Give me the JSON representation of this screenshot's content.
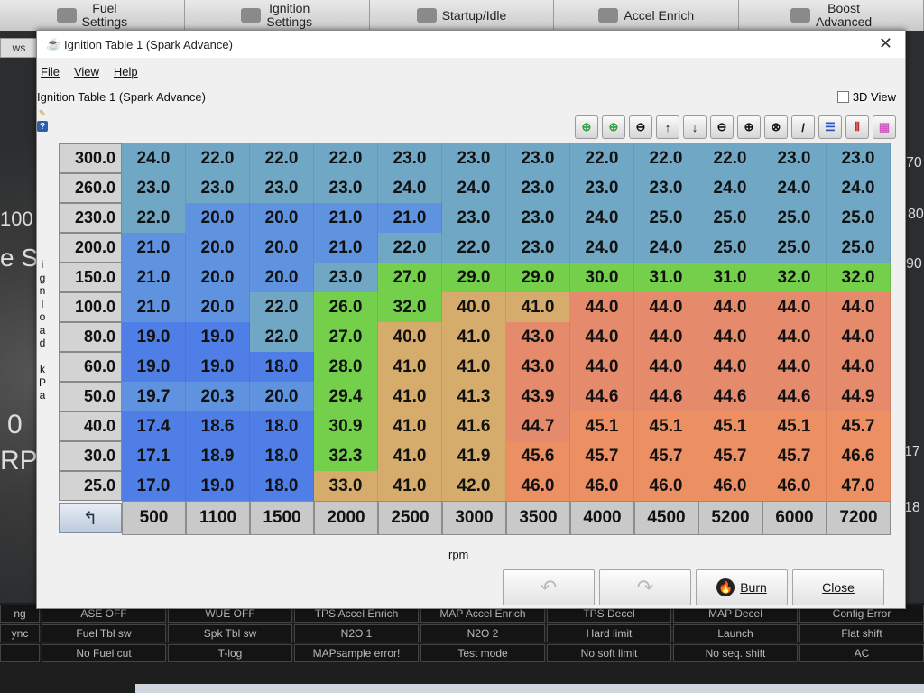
{
  "app": {
    "top_buttons": [
      {
        "label": "Fuel\nSettings",
        "icon": "injector-icon"
      },
      {
        "label": "Ignition\nSettings",
        "icon": "spark-plug-icon"
      },
      {
        "label": "Startup/Idle",
        "icon": "wrench-icon"
      },
      {
        "label": "Accel Enrich",
        "icon": "accelerator-icon"
      },
      {
        "label": "Boost\nAdvanced",
        "icon": "turbo-icon"
      }
    ],
    "side_tab": "ws",
    "gauge_labels": {
      "left_100": "100",
      "left_e": "e S",
      "left_0": "0",
      "left_rpm": "RPI",
      "right_70": "70",
      "right_80": "80",
      "right_90": "90",
      "right_17": "17",
      "right_18": "18"
    }
  },
  "dialog": {
    "title": "Ignition Table 1 (Spark Advance)",
    "menu": [
      "File",
      "View",
      "Help"
    ],
    "table_title": "Ignition Table 1 (Spark Advance)",
    "view3d_label": "3D View",
    "help_glyph": "?",
    "y_axis_label": [
      "i",
      "g",
      "n",
      "l",
      "o",
      "a",
      "d",
      "",
      "k",
      "P",
      "a"
    ],
    "x_axis_label": "rpm",
    "corner_glyph": "↰",
    "toolbar": [
      {
        "name": "increase-green-icon",
        "glyph": "⊕",
        "tone": "g"
      },
      {
        "name": "decrease-green-icon",
        "glyph": "⊕",
        "tone": "g"
      },
      {
        "name": "minus-icon",
        "glyph": "⊖",
        "tone": "k"
      },
      {
        "name": "arrow-up-icon",
        "glyph": "↑",
        "tone": "k"
      },
      {
        "name": "arrow-down-icon",
        "glyph": "↓",
        "tone": "k"
      },
      {
        "name": "decrement-icon",
        "glyph": "⊖",
        "tone": "k"
      },
      {
        "name": "increment-icon",
        "glyph": "⊕",
        "tone": "k"
      },
      {
        "name": "clear-icon",
        "glyph": "⊗",
        "tone": "k"
      },
      {
        "name": "interpolate-pen-icon",
        "glyph": "/",
        "tone": "k"
      },
      {
        "name": "smooth-rows-icon",
        "glyph": "☰",
        "tone": "k"
      },
      {
        "name": "smooth-columns-icon",
        "glyph": "⦀",
        "tone": "k"
      },
      {
        "name": "color-scale-icon",
        "glyph": "▦",
        "tone": "k"
      }
    ],
    "load_bins": [
      "300.0",
      "260.0",
      "230.0",
      "200.0",
      "150.0",
      "100.0",
      "80.0",
      "60.0",
      "50.0",
      "40.0",
      "30.0",
      "25.0"
    ],
    "rpm_bins": [
      "500",
      "1100",
      "1500",
      "2000",
      "2500",
      "3000",
      "3500",
      "4000",
      "4500",
      "5200",
      "6000",
      "7200"
    ],
    "values": [
      [
        "24.0",
        "22.0",
        "22.0",
        "22.0",
        "23.0",
        "23.0",
        "23.0",
        "22.0",
        "22.0",
        "22.0",
        "23.0",
        "23.0"
      ],
      [
        "23.0",
        "23.0",
        "23.0",
        "23.0",
        "24.0",
        "24.0",
        "23.0",
        "23.0",
        "23.0",
        "24.0",
        "24.0",
        "24.0"
      ],
      [
        "22.0",
        "20.0",
        "20.0",
        "21.0",
        "21.0",
        "23.0",
        "23.0",
        "24.0",
        "25.0",
        "25.0",
        "25.0",
        "25.0"
      ],
      [
        "21.0",
        "20.0",
        "20.0",
        "21.0",
        "22.0",
        "22.0",
        "23.0",
        "24.0",
        "24.0",
        "25.0",
        "25.0",
        "25.0"
      ],
      [
        "21.0",
        "20.0",
        "20.0",
        "23.0",
        "27.0",
        "29.0",
        "29.0",
        "30.0",
        "31.0",
        "31.0",
        "32.0",
        "32.0"
      ],
      [
        "21.0",
        "20.0",
        "22.0",
        "26.0",
        "32.0",
        "40.0",
        "41.0",
        "44.0",
        "44.0",
        "44.0",
        "44.0",
        "44.0"
      ],
      [
        "19.0",
        "19.0",
        "22.0",
        "27.0",
        "40.0",
        "41.0",
        "43.0",
        "44.0",
        "44.0",
        "44.0",
        "44.0",
        "44.0"
      ],
      [
        "19.0",
        "19.0",
        "18.0",
        "28.0",
        "41.0",
        "41.0",
        "43.0",
        "44.0",
        "44.0",
        "44.0",
        "44.0",
        "44.0"
      ],
      [
        "19.7",
        "20.3",
        "20.0",
        "29.4",
        "41.0",
        "41.3",
        "43.9",
        "44.6",
        "44.6",
        "44.6",
        "44.6",
        "44.9"
      ],
      [
        "17.4",
        "18.6",
        "18.0",
        "30.9",
        "41.0",
        "41.6",
        "44.7",
        "45.1",
        "45.1",
        "45.1",
        "45.1",
        "45.7"
      ],
      [
        "17.1",
        "18.9",
        "18.0",
        "32.3",
        "41.0",
        "41.9",
        "45.6",
        "45.7",
        "45.7",
        "45.7",
        "45.7",
        "46.6"
      ],
      [
        "17.0",
        "19.0",
        "18.0",
        "33.0",
        "41.0",
        "42.0",
        "46.0",
        "46.0",
        "46.0",
        "46.0",
        "46.0",
        "47.0"
      ]
    ],
    "colors": {
      "blue_low": "#4f7fe6",
      "blue": "#5f93e0",
      "teal": "#6fa7c4",
      "green": "#74cf4b",
      "tan": "#d6ac6c",
      "salmon": "#e58a6a",
      "orange": "#ec8f63"
    },
    "buttons": {
      "undo": "",
      "redo": "",
      "burn": "Burn",
      "close": "Close"
    }
  },
  "status_rows": [
    [
      "ng",
      "ASE OFF",
      "WUE OFF",
      "TPS Accel Enrich",
      "MAP Accel Enrich",
      "TPS Decel",
      "MAP Decel",
      "Config Error"
    ],
    [
      "ync",
      "Fuel Tbl sw",
      "Spk Tbl sw",
      "N2O 1",
      "N2O 2",
      "Hard limit",
      "Launch",
      "Flat shift"
    ],
    [
      "",
      "No Fuel cut",
      "T-log",
      "MAPsample error!",
      "Test mode",
      "No soft limit",
      "No seq. shift",
      "AC"
    ]
  ]
}
